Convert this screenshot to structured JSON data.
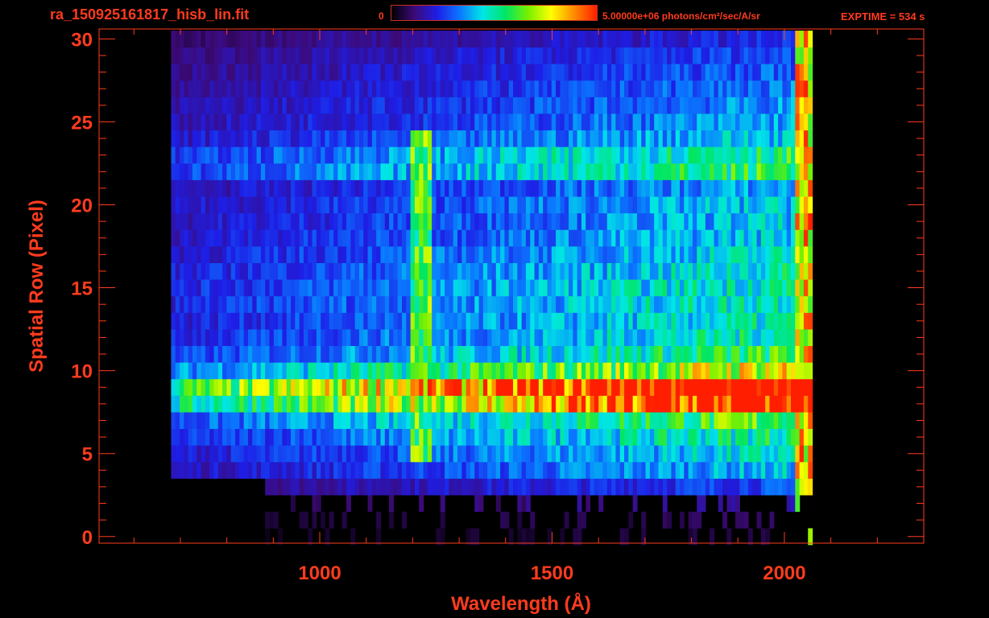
{
  "header": {
    "file_title": "ra_150925161817_hisb_lin.fit",
    "colorbar_min_label": "0",
    "colorbar_max_label": "5.00000e+06 photons/cm²/sec/A/sr",
    "exptime_label": "EXPTIME = 534 s"
  },
  "colors": {
    "axis": "#ff3b1e",
    "background": "#000000",
    "colormap": [
      "#000000",
      "#3c0a78",
      "#1e1ee6",
      "#0a78ff",
      "#00e6e6",
      "#00e664",
      "#78f000",
      "#ffff00",
      "#ff8c00",
      "#ff1e00"
    ]
  },
  "chart_data": {
    "type": "heatmap",
    "xlabel": "Wavelength (Å)",
    "ylabel": "Spatial Row (Pixel)",
    "xlim": [
      525,
      2300
    ],
    "ylim": [
      -0.4,
      30.6
    ],
    "x_ticks": [
      1000,
      1500,
      2000
    ],
    "x_tick_labels": [
      "1000",
      "1500",
      "2000"
    ],
    "x_minor_step": 100,
    "y_ticks": [
      0,
      5,
      10,
      15,
      20,
      25,
      30
    ],
    "y_tick_labels": [
      "0",
      "5",
      "10",
      "15",
      "20",
      "25",
      "30"
    ],
    "y_minor_step": 1,
    "colorbar": {
      "min": 0,
      "max": 5000000,
      "unit": "photons/cm²/sec/A/sr"
    },
    "rows": 31,
    "data_wavelength_range": [
      680,
      2060
    ],
    "approx_intensity_by_row": [
      {
        "row": 0,
        "level": 0.05
      },
      {
        "row": 1,
        "level": 0.07
      },
      {
        "row": 2,
        "level": 0.12
      },
      {
        "row": 3,
        "level": 0.22
      },
      {
        "row": 4,
        "level": 0.32
      },
      {
        "row": 5,
        "level": 0.36
      },
      {
        "row": 6,
        "level": 0.42
      },
      {
        "row": 7,
        "level": 0.5
      },
      {
        "row": 8,
        "level": 0.85
      },
      {
        "row": 9,
        "level": 1.0
      },
      {
        "row": 10,
        "level": 0.62
      },
      {
        "row": 11,
        "level": 0.46
      },
      {
        "row": 12,
        "level": 0.4
      },
      {
        "row": 13,
        "level": 0.38
      },
      {
        "row": 14,
        "level": 0.4
      },
      {
        "row": 15,
        "level": 0.4
      },
      {
        "row": 16,
        "level": 0.38
      },
      {
        "row": 17,
        "level": 0.36
      },
      {
        "row": 18,
        "level": 0.34
      },
      {
        "row": 19,
        "level": 0.33
      },
      {
        "row": 20,
        "level": 0.33
      },
      {
        "row": 21,
        "level": 0.3
      },
      {
        "row": 22,
        "level": 0.46
      },
      {
        "row": 23,
        "level": 0.44
      },
      {
        "row": 24,
        "level": 0.34
      },
      {
        "row": 25,
        "level": 0.3
      },
      {
        "row": 26,
        "level": 0.28
      },
      {
        "row": 27,
        "level": 0.26
      },
      {
        "row": 28,
        "level": 0.24
      },
      {
        "row": 29,
        "level": 0.22
      },
      {
        "row": 30,
        "level": 0.18
      }
    ],
    "emission_line_wavelength": 1216
  }
}
